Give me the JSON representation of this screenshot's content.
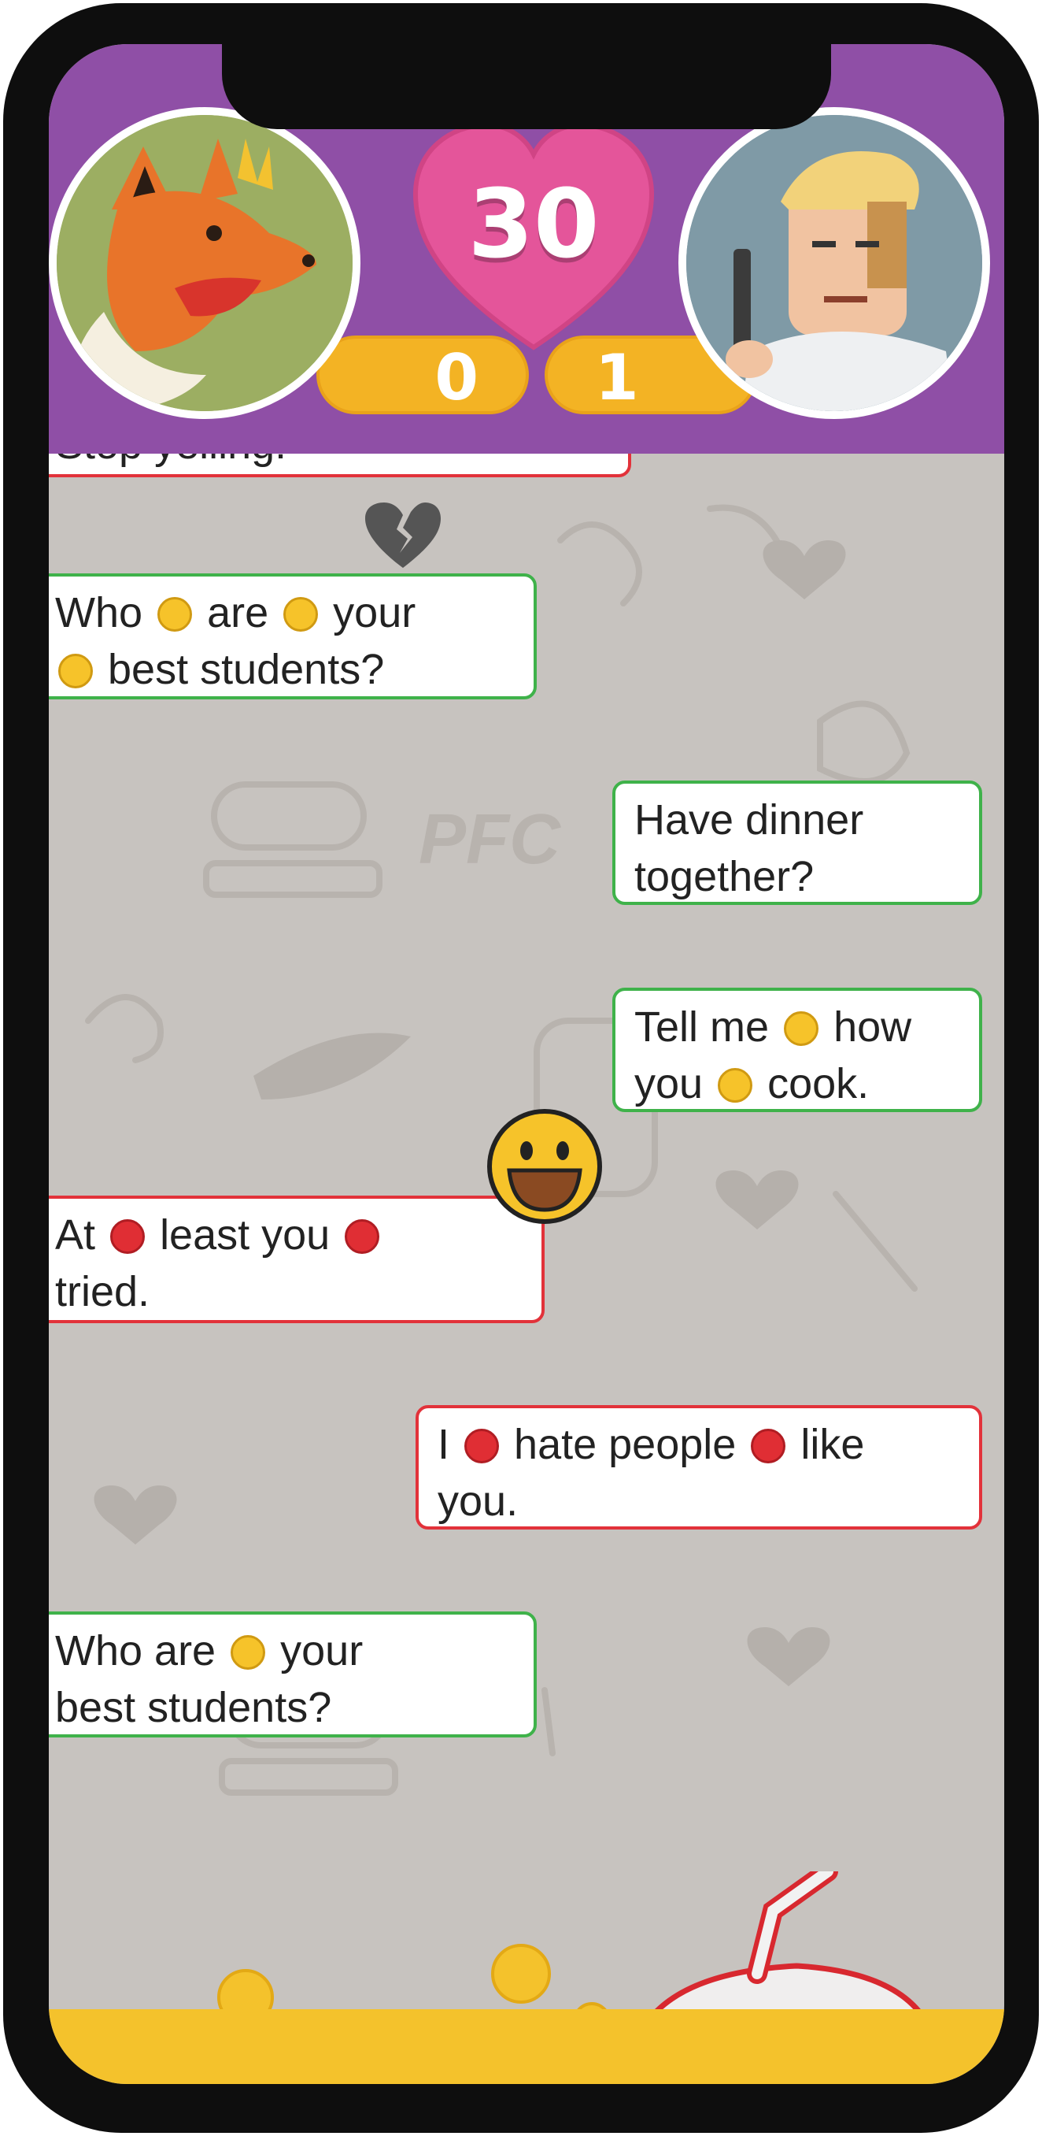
{
  "header": {
    "timer": "30",
    "score_left": "0",
    "score_right": "1"
  },
  "chat": {
    "partial_message": "Stop yelling!",
    "watermark": "PFC",
    "messages": [
      {
        "id": "m1",
        "side": "left",
        "color": "green",
        "text": "Who are your best students?"
      },
      {
        "id": "m2",
        "side": "right",
        "color": "green",
        "text": "Have dinner together?"
      },
      {
        "id": "m3",
        "side": "right",
        "color": "green",
        "text": "Tell me how you cook."
      },
      {
        "id": "m4",
        "side": "left",
        "color": "red",
        "text": "At least you tried."
      },
      {
        "id": "m5",
        "side": "right",
        "color": "red",
        "text": "I hate people like you."
      },
      {
        "id": "m6",
        "side": "left",
        "color": "green",
        "text": "Who are your best students?"
      }
    ],
    "m1": {
      "w1": "Who",
      "w2": "are",
      "w3": "your",
      "w4": "best students?"
    },
    "m2": {
      "l1": "Have dinner",
      "l2": "together?"
    },
    "m3": {
      "w1": "Tell me",
      "w2": "how",
      "w3": "you",
      "w4": "cook."
    },
    "m4": {
      "w1": "At",
      "w2": "least you",
      "w3": "tried."
    },
    "m5": {
      "w1": "I",
      "w2": "hate people",
      "w3": "like",
      "w4": "you."
    },
    "m6": {
      "w1": "Who are",
      "w2": "your",
      "w3": "best students?"
    }
  },
  "colors": {
    "header_purple": "#8f4fa6",
    "heart_pink": "#e4559a",
    "score_yellow": "#f3b324",
    "bubble_green": "#3fb24a",
    "bubble_red": "#e2323a",
    "chat_background": "#c7c3bf",
    "bottom_bar": "#f4c22c"
  },
  "icons": {
    "broken_heart": "broken-heart-icon",
    "grin": "grinning-face-icon",
    "drink": "drink-cup-icon"
  }
}
